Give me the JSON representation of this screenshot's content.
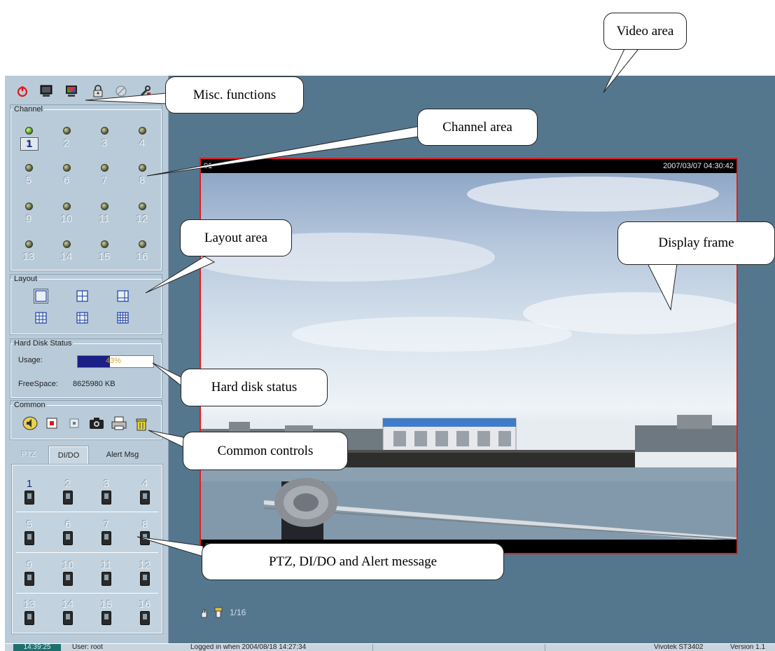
{
  "toolbar": {
    "icons": [
      "power-icon",
      "monitor-icon",
      "color-icon",
      "lock-icon",
      "disabled-icon",
      "tools-icon"
    ]
  },
  "channel": {
    "legend": "Channel",
    "numbers": [
      "1",
      "2",
      "3",
      "4",
      "5",
      "6",
      "7",
      "8",
      "9",
      "10",
      "11",
      "12",
      "13",
      "14",
      "15",
      "16"
    ],
    "selected": "1"
  },
  "layout": {
    "legend": "Layout",
    "options": [
      "1x1",
      "2x2",
      "1+3",
      "3x3",
      "1+8",
      "4x4"
    ]
  },
  "hard_disk": {
    "legend": "Hard Disk Status",
    "usage_label": "Usage:",
    "usage_value": "43%",
    "usage_fraction": 0.43,
    "free_label": "FreeSpace:",
    "free_value": "8625980 KB"
  },
  "common": {
    "legend": "Common",
    "icons": [
      "speaker-icon",
      "record-icon",
      "stop-icon",
      "snapshot-camera-icon",
      "print-icon",
      "trash-icon"
    ]
  },
  "tabs": {
    "ptz": "PTZ",
    "dido": "DI/DO",
    "alert": "Alert Msg"
  },
  "dido": {
    "numbers": [
      "1",
      "2",
      "3",
      "4",
      "5",
      "6",
      "7",
      "8",
      "9",
      "10",
      "11",
      "12",
      "13",
      "14",
      "15",
      "16"
    ],
    "active": "1"
  },
  "display": {
    "channel_id": "01",
    "timestamp": "2007/03/07 04:30:42",
    "footer": "0 : 0  00:00",
    "page": "1/16"
  },
  "status": {
    "time": "14:39:25",
    "user": "User: root",
    "logged_in": "Logged in when  2004/08/18 14:27:34",
    "product": "Vivotek ST3402",
    "version": "Version 1.1"
  },
  "callouts": {
    "video_area": "Video area",
    "misc": "Misc. functions",
    "channel_area": "Channel area",
    "layout_area": "Layout area",
    "display_frame": "Display frame",
    "hard_disk": "Hard disk status",
    "common_controls": "Common controls",
    "ptz_dido": "PTZ, DI/DO and Alert message"
  }
}
